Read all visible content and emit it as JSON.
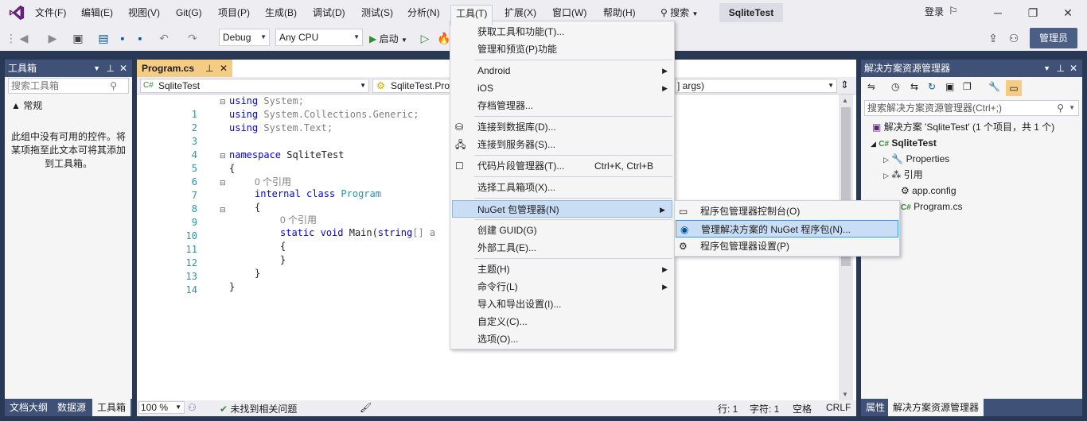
{
  "menubar": {
    "items": [
      "文件(F)",
      "编辑(E)",
      "视图(V)",
      "Git(G)",
      "项目(P)",
      "生成(B)",
      "调试(D)",
      "测试(S)",
      "分析(N)",
      "工具(T)",
      "扩展(X)",
      "窗口(W)",
      "帮助(H)"
    ],
    "search": "搜索",
    "solution_name": "SqliteTest",
    "login": "登录"
  },
  "toolbar": {
    "config": "Debug",
    "platform": "Any CPU",
    "start": "启动",
    "admin": "管理员"
  },
  "toolbox": {
    "title": "工具箱",
    "search_placeholder": "搜索工具箱",
    "section": "▲ 常规",
    "empty_text": "此组中没有可用的控件。将某项拖至此文本可将其添加到工具箱。"
  },
  "left_tabs": [
    "文档大纲",
    "数据源",
    "工具箱"
  ],
  "editor": {
    "tab": "Program.cs",
    "nav_project": "SqliteTest",
    "nav_class": "SqliteTest.Pro",
    "nav_member": "] args)",
    "zoom": "100 %",
    "status_issues": "未找到相关问题",
    "pos_line": "行: 1",
    "pos_char": "字符: 1",
    "whitespace": "空格",
    "eol": "CRLF"
  },
  "code": {
    "lines": [
      "1",
      "2",
      "3",
      "4",
      "5",
      "6",
      "7",
      "8",
      "9",
      "10",
      "11",
      "12",
      "13",
      "14"
    ],
    "ref1": "0 个引用",
    "ref2": "0 个引用",
    "l1a": "using",
    "l1b": " System;",
    "l2a": "using",
    "l2b": " System.Collections.Generic;",
    "l3a": "using",
    "l3b": " System.Text;",
    "l5a": "namespace",
    "l5b": " SqliteTest",
    "l6": "{",
    "l7a": "internal",
    "l7b": "class",
    "l7c": "Program",
    "l8": "{",
    "l9a": "static",
    "l9b": "void",
    "l9c": " Main(",
    "l9d": "string",
    "l9e": "[] a",
    "l10": "{",
    "l11": "}",
    "l12": "}",
    "l13": "}"
  },
  "tools_menu": {
    "get_tools": "获取工具和功能(T)...",
    "manage_preview": "管理和预览(P)功能",
    "android": "Android",
    "ios": "iOS",
    "archive": "存档管理器...",
    "connect_db": "连接到数据库(D)...",
    "connect_server": "连接到服务器(S)...",
    "snippets": "代码片段管理器(T)...",
    "snippets_sc": "Ctrl+K, Ctrl+B",
    "choose_toolbox": "选择工具箱项(X)...",
    "nuget": "NuGet 包管理器(N)",
    "create_guid": "创建 GUID(G)",
    "external": "外部工具(E)...",
    "theme": "主题(H)",
    "cmdline": "命令行(L)",
    "import_export": "导入和导出设置(I)...",
    "customize": "自定义(C)...",
    "options": "选项(O)..."
  },
  "nuget_sub": {
    "console": "程序包管理器控制台(O)",
    "manage": "管理解决方案的 NuGet 程序包(N)...",
    "settings": "程序包管理器设置(P)"
  },
  "solution_explorer": {
    "title": "解决方案资源管理器",
    "search_placeholder": "搜索解决方案资源管理器(Ctrl+;)",
    "solution": "解决方案 'SqliteTest' (1 个项目，共 1 个)",
    "project": "SqliteTest",
    "items": [
      "Properties",
      "引用",
      "app.config",
      "Program.cs"
    ]
  },
  "right_tabs": [
    "属性",
    "解决方案资源管理器"
  ],
  "colors": {
    "accent": "#293955",
    "active_tab": "#f5cc84",
    "menu_highlight": "#c9def5"
  }
}
